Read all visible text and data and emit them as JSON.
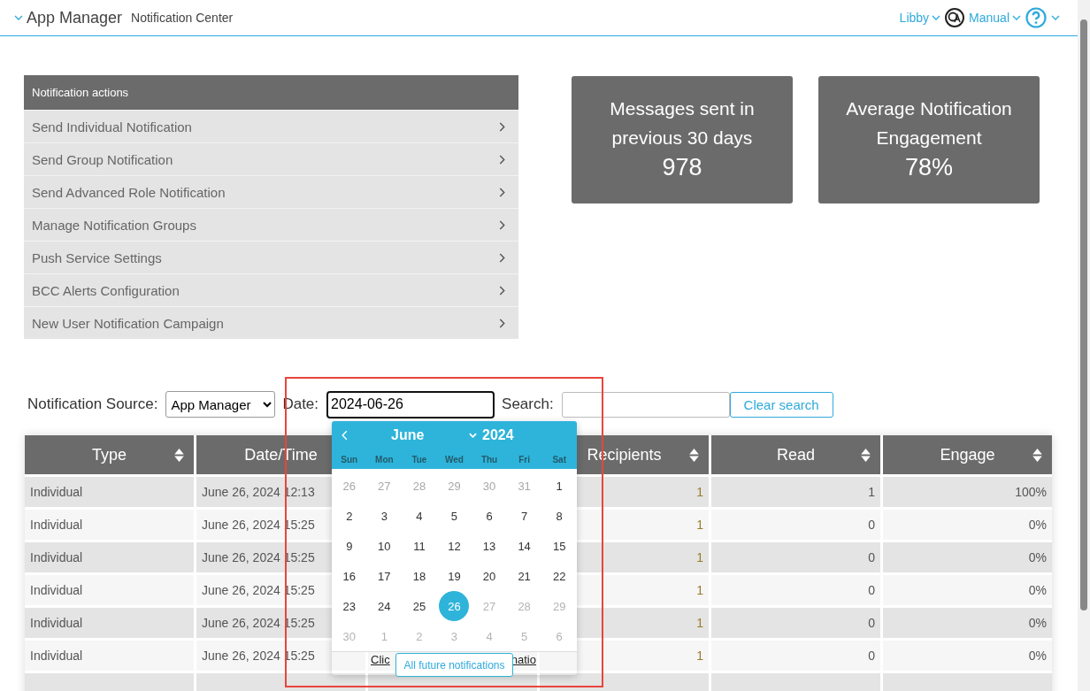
{
  "header": {
    "title": "App Manager",
    "subtitle": "Notification Center",
    "user": "Libby",
    "manual": "Manual"
  },
  "actions": {
    "title": "Notification actions",
    "items": [
      {
        "label": "Send Individual Notification"
      },
      {
        "label": "Send Group Notification"
      },
      {
        "label": "Send Advanced Role Notification"
      },
      {
        "label": "Manage Notification Groups"
      },
      {
        "label": "Push Service Settings"
      },
      {
        "label": "BCC Alerts Configuration"
      },
      {
        "label": "New User Notification Campaign"
      }
    ]
  },
  "stats": [
    {
      "label": "Messages sent in previous 30 days",
      "value": "978"
    },
    {
      "label": "Average Notification Engagement",
      "value": "78%"
    }
  ],
  "filters": {
    "source_label": "Notification Source:",
    "source_value": "App Manager",
    "date_label": "Date:",
    "date_value": "2024-06-26",
    "search_label": "Search:",
    "clear_button": "Clear search"
  },
  "table": {
    "columns": [
      {
        "label": "Type"
      },
      {
        "label": "Date/Time"
      },
      {
        "label": "Recipients"
      },
      {
        "label": "Read"
      },
      {
        "label": "Engage"
      }
    ],
    "rows": [
      {
        "type": "Individual",
        "datetime": "June 26, 2024 12:13",
        "recipients": "1",
        "read": "1",
        "engage": "100%"
      },
      {
        "type": "Individual",
        "datetime": "June 26, 2024 15:25",
        "recipients": "1",
        "read": "0",
        "engage": "0%"
      },
      {
        "type": "Individual",
        "datetime": "June 26, 2024 15:25",
        "recipients": "1",
        "read": "0",
        "engage": "0%"
      },
      {
        "type": "Individual",
        "datetime": "June 26, 2024 15:25",
        "recipients": "1",
        "read": "0",
        "engage": "0%"
      },
      {
        "type": "Individual",
        "datetime": "June 26, 2024 15:25",
        "recipients": "1",
        "read": "0",
        "engage": "0%"
      },
      {
        "type": "Individual",
        "datetime": "June 26, 2024 15:25",
        "column_3": [
          "Clic",
          "natio"
        ],
        "recipients": "1",
        "read": "0",
        "engage": "0%"
      }
    ]
  },
  "calendar": {
    "month": "June",
    "year": "2024",
    "weekdays": [
      "Sun",
      "Mon",
      "Tue",
      "Wed",
      "Thu",
      "Fri",
      "Sat"
    ],
    "days": [
      {
        "label": "26",
        "kind": "other",
        "selected": false
      },
      {
        "label": "27",
        "kind": "other",
        "selected": false
      },
      {
        "label": "28",
        "kind": "other",
        "selected": false
      },
      {
        "label": "29",
        "kind": "other",
        "selected": false
      },
      {
        "label": "30",
        "kind": "other",
        "selected": false
      },
      {
        "label": "31",
        "kind": "other",
        "selected": false
      },
      {
        "label": "1",
        "kind": "day",
        "selected": false
      },
      {
        "label": "2",
        "kind": "day",
        "selected": false
      },
      {
        "label": "3",
        "kind": "day",
        "selected": false
      },
      {
        "label": "4",
        "kind": "day",
        "selected": false
      },
      {
        "label": "5",
        "kind": "day",
        "selected": false
      },
      {
        "label": "6",
        "kind": "day",
        "selected": false
      },
      {
        "label": "7",
        "kind": "day",
        "selected": false
      },
      {
        "label": "8",
        "kind": "day",
        "selected": false
      },
      {
        "label": "9",
        "kind": "day",
        "selected": false
      },
      {
        "label": "10",
        "kind": "day",
        "selected": false
      },
      {
        "label": "11",
        "kind": "day",
        "selected": false
      },
      {
        "label": "12",
        "kind": "day",
        "selected": false
      },
      {
        "label": "13",
        "kind": "day",
        "selected": false
      },
      {
        "label": "14",
        "kind": "day",
        "selected": false
      },
      {
        "label": "15",
        "kind": "day",
        "selected": false
      },
      {
        "label": "16",
        "kind": "day",
        "selected": false
      },
      {
        "label": "17",
        "kind": "day",
        "selected": false
      },
      {
        "label": "18",
        "kind": "day",
        "selected": false
      },
      {
        "label": "19",
        "kind": "day",
        "selected": false
      },
      {
        "label": "20",
        "kind": "day",
        "selected": false
      },
      {
        "label": "21",
        "kind": "day",
        "selected": false
      },
      {
        "label": "22",
        "kind": "day",
        "selected": false
      },
      {
        "label": "23",
        "kind": "day",
        "selected": false
      },
      {
        "label": "24",
        "kind": "day",
        "selected": false
      },
      {
        "label": "25",
        "kind": "day",
        "selected": false
      },
      {
        "label": "26",
        "kind": "day",
        "selected": true
      },
      {
        "label": "27",
        "kind": "disabled",
        "selected": false
      },
      {
        "label": "28",
        "kind": "disabled",
        "selected": false
      },
      {
        "label": "29",
        "kind": "disabled",
        "selected": false
      },
      {
        "label": "30",
        "kind": "disabled",
        "selected": false
      },
      {
        "label": "1",
        "kind": "disabled",
        "selected": false
      },
      {
        "label": "2",
        "kind": "disabled",
        "selected": false
      },
      {
        "label": "3",
        "kind": "disabled",
        "selected": false
      },
      {
        "label": "4",
        "kind": "disabled",
        "selected": false
      },
      {
        "label": "5",
        "kind": "disabled",
        "selected": false
      },
      {
        "label": "6",
        "kind": "disabled",
        "selected": false
      }
    ],
    "footer_button": "All future notifications"
  }
}
